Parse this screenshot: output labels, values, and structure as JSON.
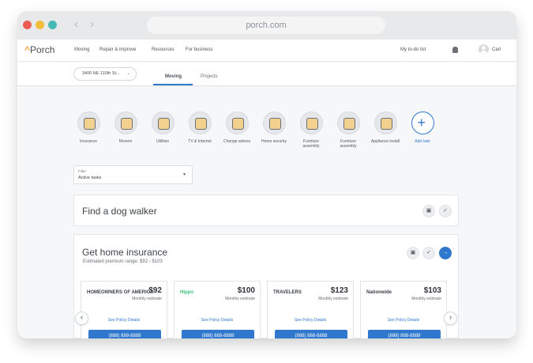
{
  "browser": {
    "url": "porch.com"
  },
  "brand": {
    "name": "Porch",
    "accent": "#2F78CD",
    "logo_color": "#F2A33A"
  },
  "topnav": {
    "links": [
      "Moving",
      "Repair & improve",
      "Resources",
      "For business"
    ],
    "todo": "My to-do list",
    "user": "Carl"
  },
  "subnav": {
    "address": "3400 NE 110th St...",
    "tabs": [
      "Moving",
      "Projects"
    ]
  },
  "services": [
    {
      "label": "Insurance",
      "icon": "insurance-icon"
    },
    {
      "label": "Movers",
      "icon": "movers-icon"
    },
    {
      "label": "Utilities",
      "icon": "utilities-icon"
    },
    {
      "label": "TV & Internet",
      "icon": "tv-internet-icon"
    },
    {
      "label": "Change adress",
      "icon": "change-address-icon"
    },
    {
      "label": "Home security",
      "icon": "home-security-icon"
    },
    {
      "label": "Furniture assembly",
      "icon": "furniture-assembly-icon"
    },
    {
      "label": "Furniture assembly",
      "icon": "furniture-assembly-icon"
    },
    {
      "label": "Appliance install",
      "icon": "appliance-install-icon"
    },
    {
      "label": "Add task",
      "icon": "plus-icon"
    }
  ],
  "filter": {
    "label": "Filter",
    "value": "Active tasks"
  },
  "cards": {
    "dog_walker": {
      "title": "Find a dog walker"
    },
    "insurance": {
      "title": "Get home insurance",
      "subtitle": "Estimated premium range: $92 - $103"
    }
  },
  "quotes": [
    {
      "brand": "HOMEOWNERS OF AMERICA",
      "price": "$92",
      "estimate": "Monthly estimate",
      "link": "See Policy Details",
      "phone": "(888) 888-8888"
    },
    {
      "brand": "Hippo",
      "price": "$100",
      "estimate": "Monthly estimate",
      "link": "See Policy Details",
      "phone": "(888) 888-8888"
    },
    {
      "brand": "TRAVELERS",
      "price": "$123",
      "estimate": "Monthly estimate",
      "link": "See Policy Details",
      "phone": "(888) 888-8888"
    },
    {
      "brand": "Nationwide",
      "price": "$103",
      "estimate": "Monthly estimate",
      "link": "See Policy Details",
      "phone": "(888) 888-8888"
    }
  ]
}
